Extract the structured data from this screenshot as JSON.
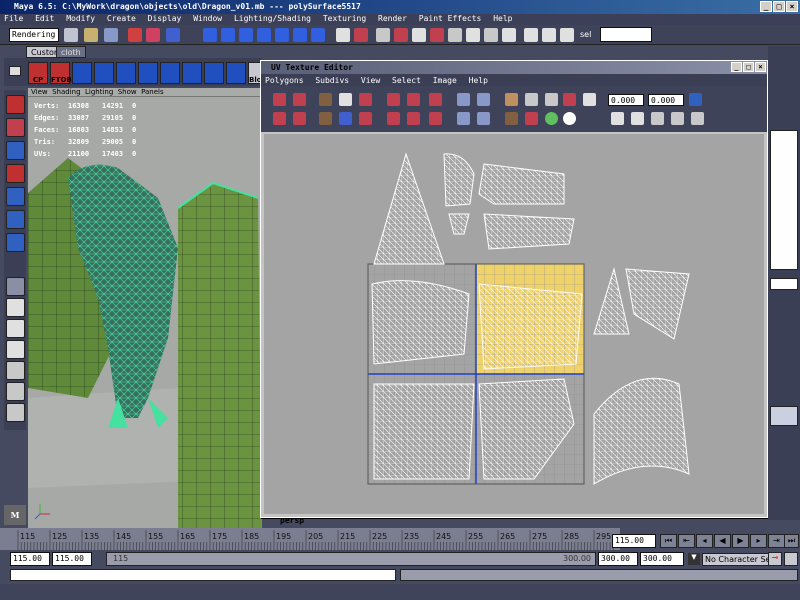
{
  "window": {
    "title": "Maya 6.5: C:\\MyWork\\dragon\\objects\\old\\Dragon_v01.mb   ---   polySurface5517"
  },
  "menubar": [
    "File",
    "Edit",
    "Modify",
    "Create",
    "Display",
    "Window",
    "Lighting/Shading",
    "Texturing",
    "Render",
    "Paint Effects",
    "Help"
  ],
  "statusline": {
    "menu_set": "Rendering",
    "sel_label": "sel"
  },
  "shelf": {
    "tabs": [
      "Custom",
      "cloth"
    ],
    "icons": [
      "CP",
      "FTOB",
      "",
      "",
      "",
      "",
      "",
      "",
      "",
      "",
      "Blo"
    ]
  },
  "viewport": {
    "menu": [
      "View",
      "Shading",
      "Lighting",
      "Show",
      "Panels"
    ],
    "hud": [
      {
        "label": "Verts:",
        "a": "16308",
        "b": "14291",
        "c": "0"
      },
      {
        "label": "Edges:",
        "a": "33087",
        "b": "29105",
        "c": "0"
      },
      {
        "label": "Faces:",
        "a": "16803",
        "b": "14853",
        "c": "0"
      },
      {
        "label": "Tris:",
        "a": "32809",
        "b": "29005",
        "c": "0"
      },
      {
        "label": "UVs:",
        "a": "21100",
        "b": "17403",
        "c": "0"
      }
    ],
    "camera": "persp"
  },
  "uv_editor": {
    "title": "UV Texture Editor",
    "menu": [
      "Polygons",
      "Subdivs",
      "View",
      "Select",
      "Image",
      "Help"
    ],
    "u_value": "0.000",
    "v_value": "0.000"
  },
  "timeslider": {
    "ticks": [
      "115",
      "125",
      "135",
      "145",
      "155",
      "165",
      "175",
      "185",
      "195",
      "205",
      "215",
      "225",
      "235",
      "245",
      "255",
      "265",
      "275",
      "285",
      "295"
    ],
    "current_frame": "115.00"
  },
  "rangeslider": {
    "start": "115.00",
    "inner_start": "115.00",
    "range_label_left": "115",
    "range_label_right": "300.00",
    "inner_end": "300.00",
    "end": "300.00",
    "character_set": "No Character Set"
  },
  "colors": {
    "ui_bg": "#454a60",
    "viewport_bg": "#a7a9a7",
    "wire_green": "#46e0a0",
    "uv_highlight": "#efd36a"
  }
}
